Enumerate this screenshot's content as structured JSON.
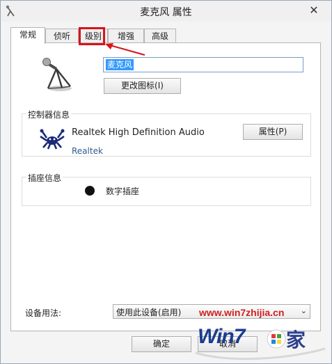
{
  "window": {
    "title": "麦克风 属性",
    "close_glyph": "✕"
  },
  "tabs": [
    {
      "label": "常规",
      "active": true
    },
    {
      "label": "侦听",
      "active": false
    },
    {
      "label": "级别",
      "active": false
    },
    {
      "label": "增强",
      "active": false
    },
    {
      "label": "高级",
      "active": false
    }
  ],
  "device": {
    "icon": "microphone-icon",
    "name": "麦克风",
    "change_icon_label": "更改图标(I)"
  },
  "controller": {
    "group_label": "控制器信息",
    "name": "Realtek High Definition Audio",
    "vendor": "Realtek",
    "icon": "realtek-crab-icon",
    "properties_label": "属性(P)"
  },
  "jack": {
    "group_label": "插座信息",
    "type": "数字插座"
  },
  "usage": {
    "label": "设备用法:",
    "selected": "使用此设备(启用)"
  },
  "buttons": {
    "ok": "确定",
    "cancel": "取消"
  },
  "annotation": {
    "highlight_color": "#d8131a",
    "arrow_color": "#d8131a"
  },
  "watermark": {
    "url": "www.win7zhijia.cn",
    "word": "Win7",
    "suffix": "家"
  }
}
